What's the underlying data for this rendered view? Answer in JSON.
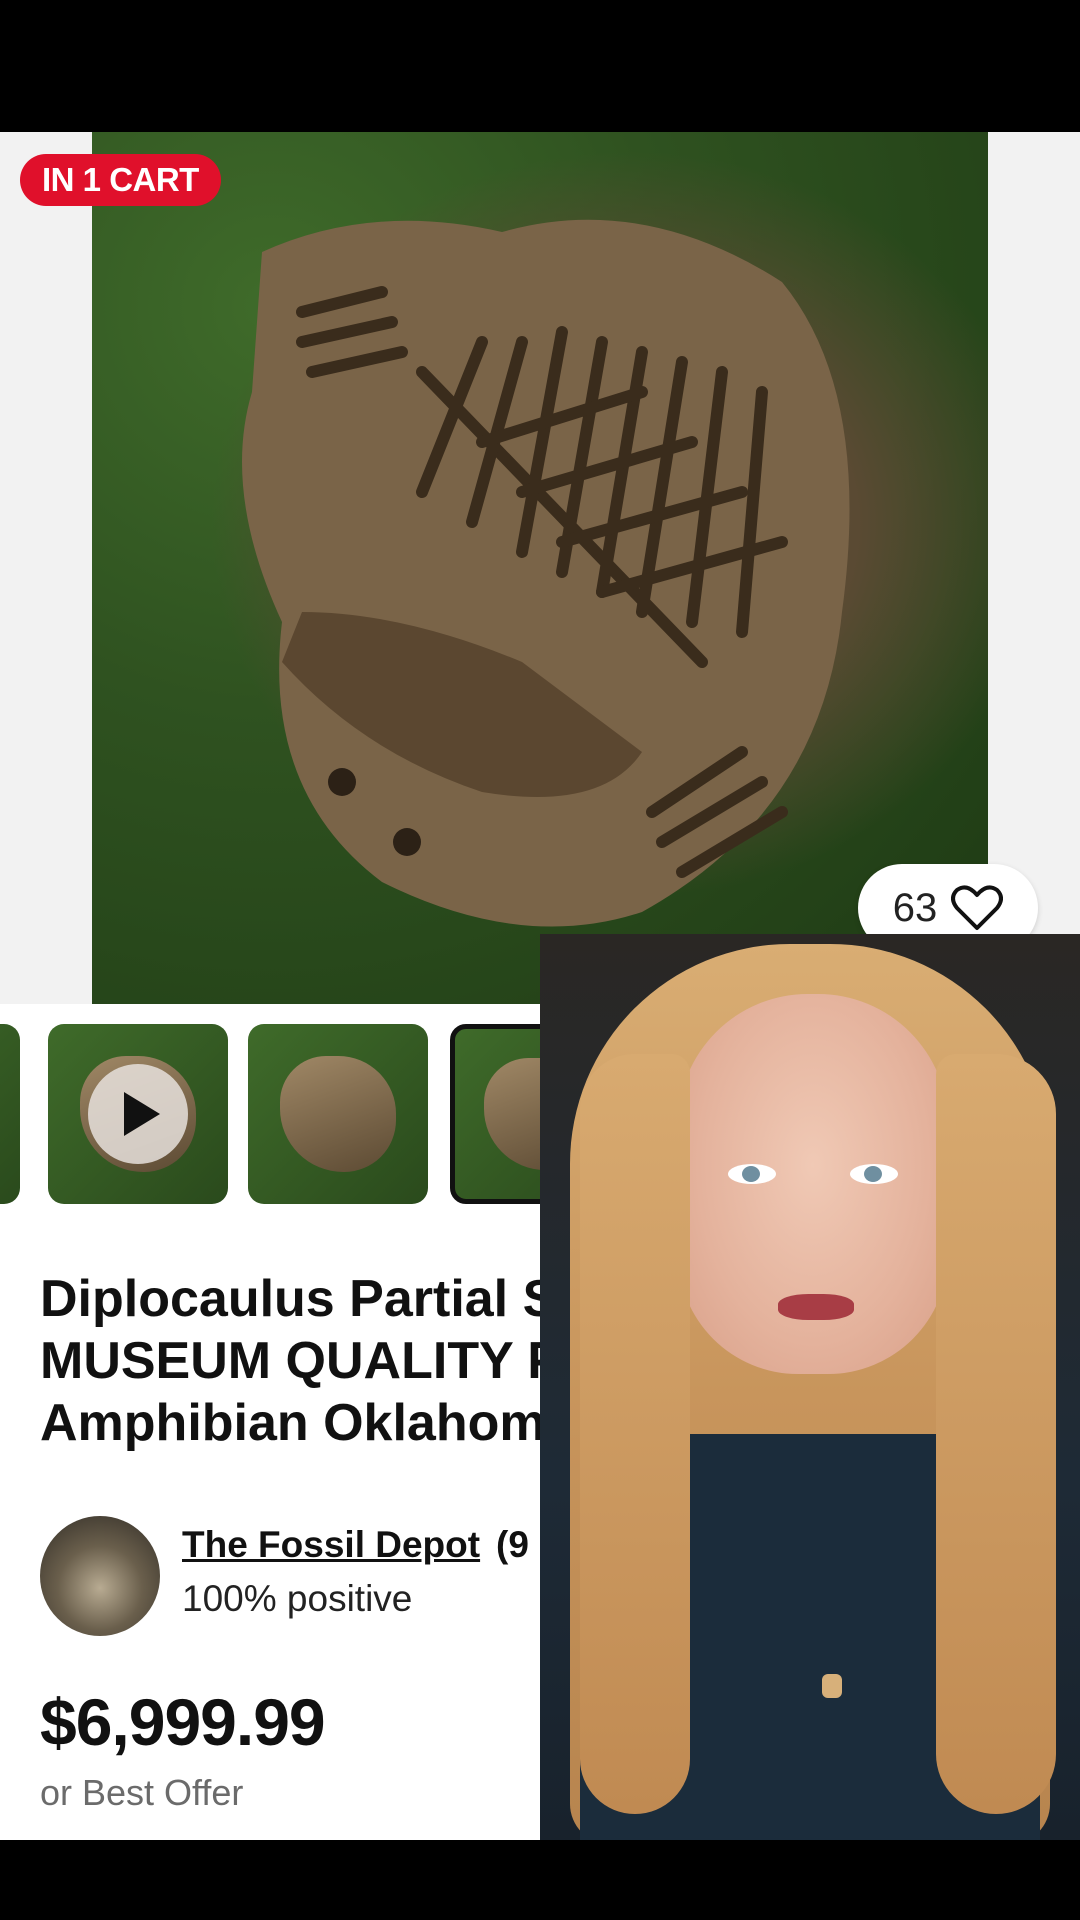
{
  "listing": {
    "cart_badge": "IN 1 CART",
    "like_count": "63",
    "title": "Diplocaulus Partial Sk… MUSEUM QUALITY P… Amphibian Oklahom…",
    "title_lines": [
      "Diplocaulus Partial Sk",
      "MUSEUM QUALITY P",
      "Amphibian Oklahom"
    ],
    "seller": {
      "name": "The Fossil Depot",
      "count_prefix": "(9",
      "rating": "100% positive"
    },
    "price": "$6,999.99",
    "offer_text": "or Best Offer"
  },
  "thumbnails": [
    {
      "label": "thumb-video",
      "is_video": true,
      "active": false
    },
    {
      "label": "thumb-2",
      "is_video": false,
      "active": false
    },
    {
      "label": "thumb-3",
      "is_video": false,
      "active": true
    }
  ],
  "colors": {
    "badge": "#e0102b",
    "text": "#111111",
    "muted": "#6b6b6b"
  },
  "icons": [
    "heart-icon",
    "play-icon"
  ]
}
